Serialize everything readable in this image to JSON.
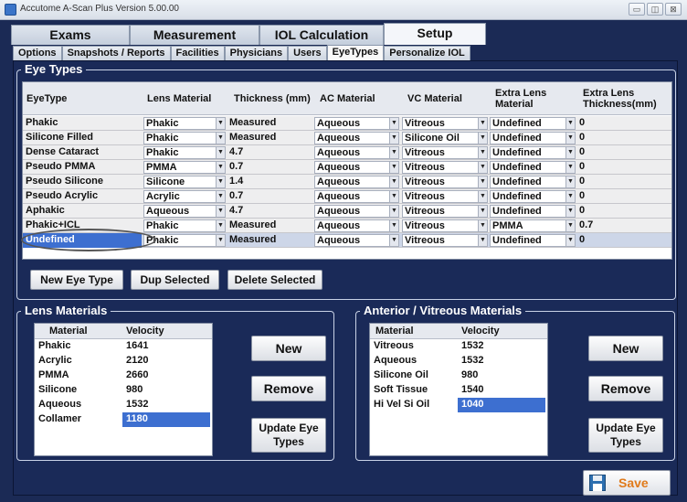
{
  "window": {
    "title": "Accutome A-Scan Plus Version 5.00.00",
    "controls": [
      "▭",
      "◫",
      "⊠"
    ]
  },
  "main_tabs": [
    {
      "label": "Exams",
      "active": false
    },
    {
      "label": "Measurement",
      "active": false
    },
    {
      "label": "IOL Calculation",
      "active": false
    },
    {
      "label": "Setup",
      "active": true
    }
  ],
  "sub_tabs": [
    {
      "label": "Options",
      "active": false
    },
    {
      "label": "Snapshots / Reports",
      "active": false
    },
    {
      "label": "Facilities",
      "active": false
    },
    {
      "label": "Physicians",
      "active": false
    },
    {
      "label": "Users",
      "active": false
    },
    {
      "label": "EyeTypes",
      "active": true
    },
    {
      "label": "Personalize IOL",
      "active": false
    }
  ],
  "eye_types": {
    "legend": "Eye Types",
    "headers": [
      "EyeType",
      "Lens Material",
      "Thickness (mm)",
      "AC Material",
      "VC Material",
      "Extra Lens Material",
      "Extra Lens Thickness(mm)"
    ],
    "rows": [
      {
        "name": "Phakic",
        "lens": "Phakic",
        "thickness": "Measured",
        "ac": "Aqueous",
        "vc": "Vitreous",
        "extra": "Undefined",
        "extra_thickness": "0",
        "selected": false
      },
      {
        "name": "Silicone Filled",
        "lens": "Phakic",
        "thickness": "Measured",
        "ac": "Aqueous",
        "vc": "Silicone Oil",
        "extra": "Undefined",
        "extra_thickness": "0",
        "selected": false
      },
      {
        "name": "Dense Cataract",
        "lens": "Phakic",
        "thickness": "4.7",
        "ac": "Aqueous",
        "vc": "Vitreous",
        "extra": "Undefined",
        "extra_thickness": "0",
        "selected": false
      },
      {
        "name": "Pseudo PMMA",
        "lens": "PMMA",
        "thickness": "0.7",
        "ac": "Aqueous",
        "vc": "Vitreous",
        "extra": "Undefined",
        "extra_thickness": "0",
        "selected": false
      },
      {
        "name": "Pseudo Silicone",
        "lens": "Silicone",
        "thickness": "1.4",
        "ac": "Aqueous",
        "vc": "Vitreous",
        "extra": "Undefined",
        "extra_thickness": "0",
        "selected": false
      },
      {
        "name": "Pseudo Acrylic",
        "lens": "Acrylic",
        "thickness": "0.7",
        "ac": "Aqueous",
        "vc": "Vitreous",
        "extra": "Undefined",
        "extra_thickness": "0",
        "selected": false
      },
      {
        "name": "Aphakic",
        "lens": "Aqueous",
        "thickness": "4.7",
        "ac": "Aqueous",
        "vc": "Vitreous",
        "extra": "Undefined",
        "extra_thickness": "0",
        "selected": false
      },
      {
        "name": "Phakic+ICL",
        "lens": "Phakic",
        "thickness": "Measured",
        "ac": "Aqueous",
        "vc": "Vitreous",
        "extra": "PMMA",
        "extra_thickness": "0.7",
        "selected": false
      },
      {
        "name": "Undefined",
        "lens": "Phakic",
        "thickness": "Measured",
        "ac": "Aqueous",
        "vc": "Vitreous",
        "extra": "Undefined",
        "extra_thickness": "0",
        "selected": true
      }
    ],
    "buttons": {
      "new": "New Eye Type",
      "dup": "Dup Selected",
      "delete": "Delete Selected"
    }
  },
  "lens_materials": {
    "legend": "Lens Materials",
    "headers": [
      "Material",
      "Velocity"
    ],
    "rows": [
      {
        "material": "Phakic",
        "velocity": "1641",
        "selected": false
      },
      {
        "material": "Acrylic",
        "velocity": "2120",
        "selected": false
      },
      {
        "material": "PMMA",
        "velocity": "2660",
        "selected": false
      },
      {
        "material": "Silicone",
        "velocity": "980",
        "selected": false
      },
      {
        "material": "Aqueous",
        "velocity": "1532",
        "selected": false
      },
      {
        "material": "Collamer",
        "velocity": "1180",
        "selected": true
      }
    ],
    "buttons": {
      "new": "New",
      "remove": "Remove",
      "update": "Update Eye Types"
    }
  },
  "av_materials": {
    "legend": "Anterior / Vitreous Materials",
    "headers": [
      "Material",
      "Velocity"
    ],
    "rows": [
      {
        "material": "Vitreous",
        "velocity": "1532",
        "selected": false
      },
      {
        "material": "Aqueous",
        "velocity": "1532",
        "selected": false
      },
      {
        "material": "Silicone Oil",
        "velocity": "980",
        "selected": false
      },
      {
        "material": "Soft Tissue",
        "velocity": "1540",
        "selected": false
      },
      {
        "material": "Hi Vel Si Oil",
        "velocity": "1040",
        "selected": true
      }
    ],
    "buttons": {
      "new": "New",
      "remove": "Remove",
      "update": "Update Eye Types"
    }
  },
  "save": {
    "label": "Save"
  },
  "colors": {
    "panel": "#1a2a58",
    "selection": "#3d6fd0",
    "save_text": "#e07a1a"
  }
}
